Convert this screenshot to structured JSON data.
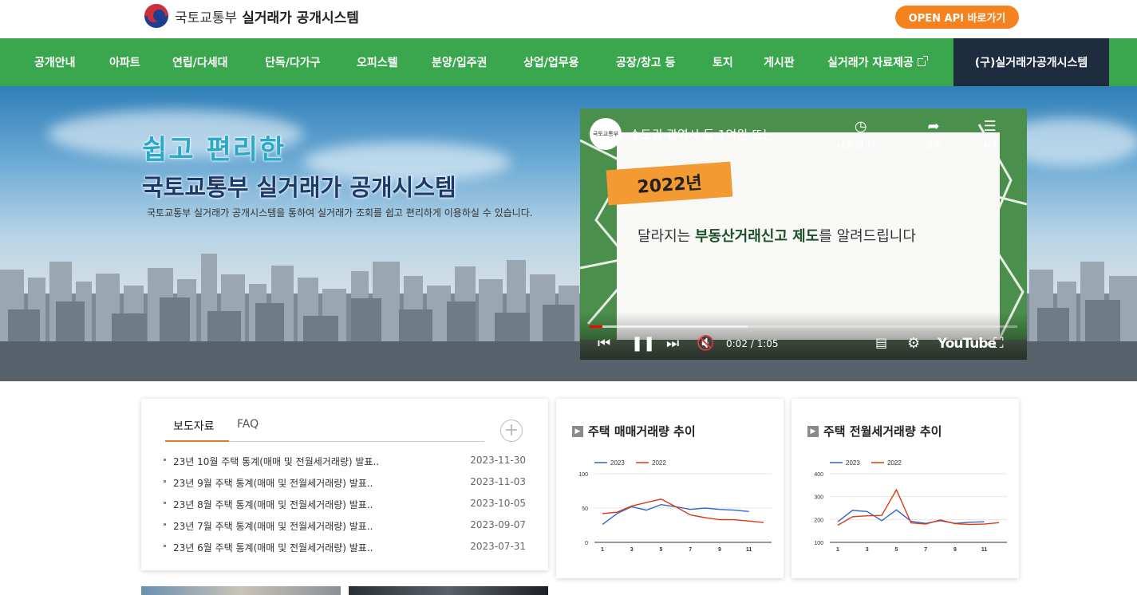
{
  "header": {
    "ministry": "국토교통부",
    "system": "실거래가 공개시스템",
    "open_api": "OPEN API 바로가기"
  },
  "nav": [
    {
      "label": "공개안내"
    },
    {
      "label": "아파트"
    },
    {
      "label": "연립/다세대"
    },
    {
      "label": "단독/다가구"
    },
    {
      "label": "오피스텔"
    },
    {
      "label": "분양/입주권"
    },
    {
      "label": "상업/업무용"
    },
    {
      "label": "공장/창고 등"
    },
    {
      "label": "토지"
    },
    {
      "label": "게시판"
    },
    {
      "label": "실거래가 자료제공"
    },
    {
      "label": "(구)실거래가공개시스템"
    }
  ],
  "hero": {
    "title1": "쉽고 편리한",
    "title2": "국토교통부 실거래가 공개시스템",
    "desc": "국토교통부 실거래가 공개시스템을 통하여 실거래가 조회를 쉽고 편리하게 이용하실 수 있습니다."
  },
  "video": {
    "title": "수도권·광역시 등 1억원 또는 ...",
    "watch_later": "나중에 시...",
    "share": "공유",
    "playlist": "1/1",
    "year_tag": "2022년",
    "headline_pre": "달라지는 ",
    "headline_bold": "부동산거래신고 제도",
    "headline_post": "를 알려드립니다",
    "time": "0:02 / 1:05",
    "youtube": "YouTube",
    "progress": 0.03,
    "buffered": 0.37,
    "avatar_text": "국토교통부"
  },
  "news": {
    "tab_active": "보도자료",
    "tab_other": "FAQ",
    "plus": "+",
    "items": [
      {
        "title": "23년 10월 주택 통계(매매 및 전월세거래량) 발표..",
        "date": "2023-11-30"
      },
      {
        "title": "23년 9월 주택 통계(매매 및 전월세거래량) 발표..",
        "date": "2023-11-03"
      },
      {
        "title": "23년 8월 주택 통계(매매 및 전월세거래량) 발표..",
        "date": "2023-10-05"
      },
      {
        "title": "23년 7월 주택 통계(매매 및 전월세거래량) 발표..",
        "date": "2023-09-07"
      },
      {
        "title": "23년 6월 주택 통계(매매 및 전월세거래량) 발표..",
        "date": "2023-07-31"
      }
    ]
  },
  "chart_data": [
    {
      "type": "line",
      "title": "주택 매매거래량 추이",
      "x": [
        1,
        2,
        3,
        4,
        5,
        6,
        7,
        8,
        9,
        10,
        11,
        12
      ],
      "x_ticks": [
        1,
        3,
        5,
        7,
        9,
        11
      ],
      "ylim": [
        0,
        100
      ],
      "y_ticks": [
        0,
        50,
        100
      ],
      "grid": true,
      "legend": "top-left",
      "series": [
        {
          "name": "2023",
          "color": "#3366cc",
          "values": [
            26,
            42,
            52,
            47,
            55,
            52,
            48,
            50,
            48,
            47,
            45,
            null
          ]
        },
        {
          "name": "2022",
          "color": "#dc3912",
          "values": [
            42,
            44,
            53,
            58,
            63,
            52,
            40,
            36,
            33,
            33,
            31,
            29
          ]
        }
      ]
    },
    {
      "type": "line",
      "title": "주택 전월세거래량 추이",
      "x": [
        1,
        2,
        3,
        4,
        5,
        6,
        7,
        8,
        9,
        10,
        11,
        12
      ],
      "x_ticks": [
        1,
        3,
        5,
        7,
        9,
        11
      ],
      "ylim": [
        100,
        400
      ],
      "y_ticks": [
        100,
        200,
        300,
        400
      ],
      "grid": true,
      "legend": "top-left",
      "series": [
        {
          "name": "2023",
          "color": "#3366cc",
          "values": [
            190,
            240,
            235,
            195,
            242,
            192,
            183,
            195,
            183,
            188,
            190,
            null
          ]
        },
        {
          "name": "2022",
          "color": "#dc3912",
          "values": [
            175,
            212,
            216,
            218,
            330,
            185,
            180,
            198,
            182,
            178,
            180,
            186
          ]
        }
      ]
    }
  ],
  "colors": {
    "nav_green": "#3aa64e",
    "nav_dark": "#1e2c3f",
    "accent_orange": "#f5821f",
    "tab_underline": "#e6762b"
  }
}
